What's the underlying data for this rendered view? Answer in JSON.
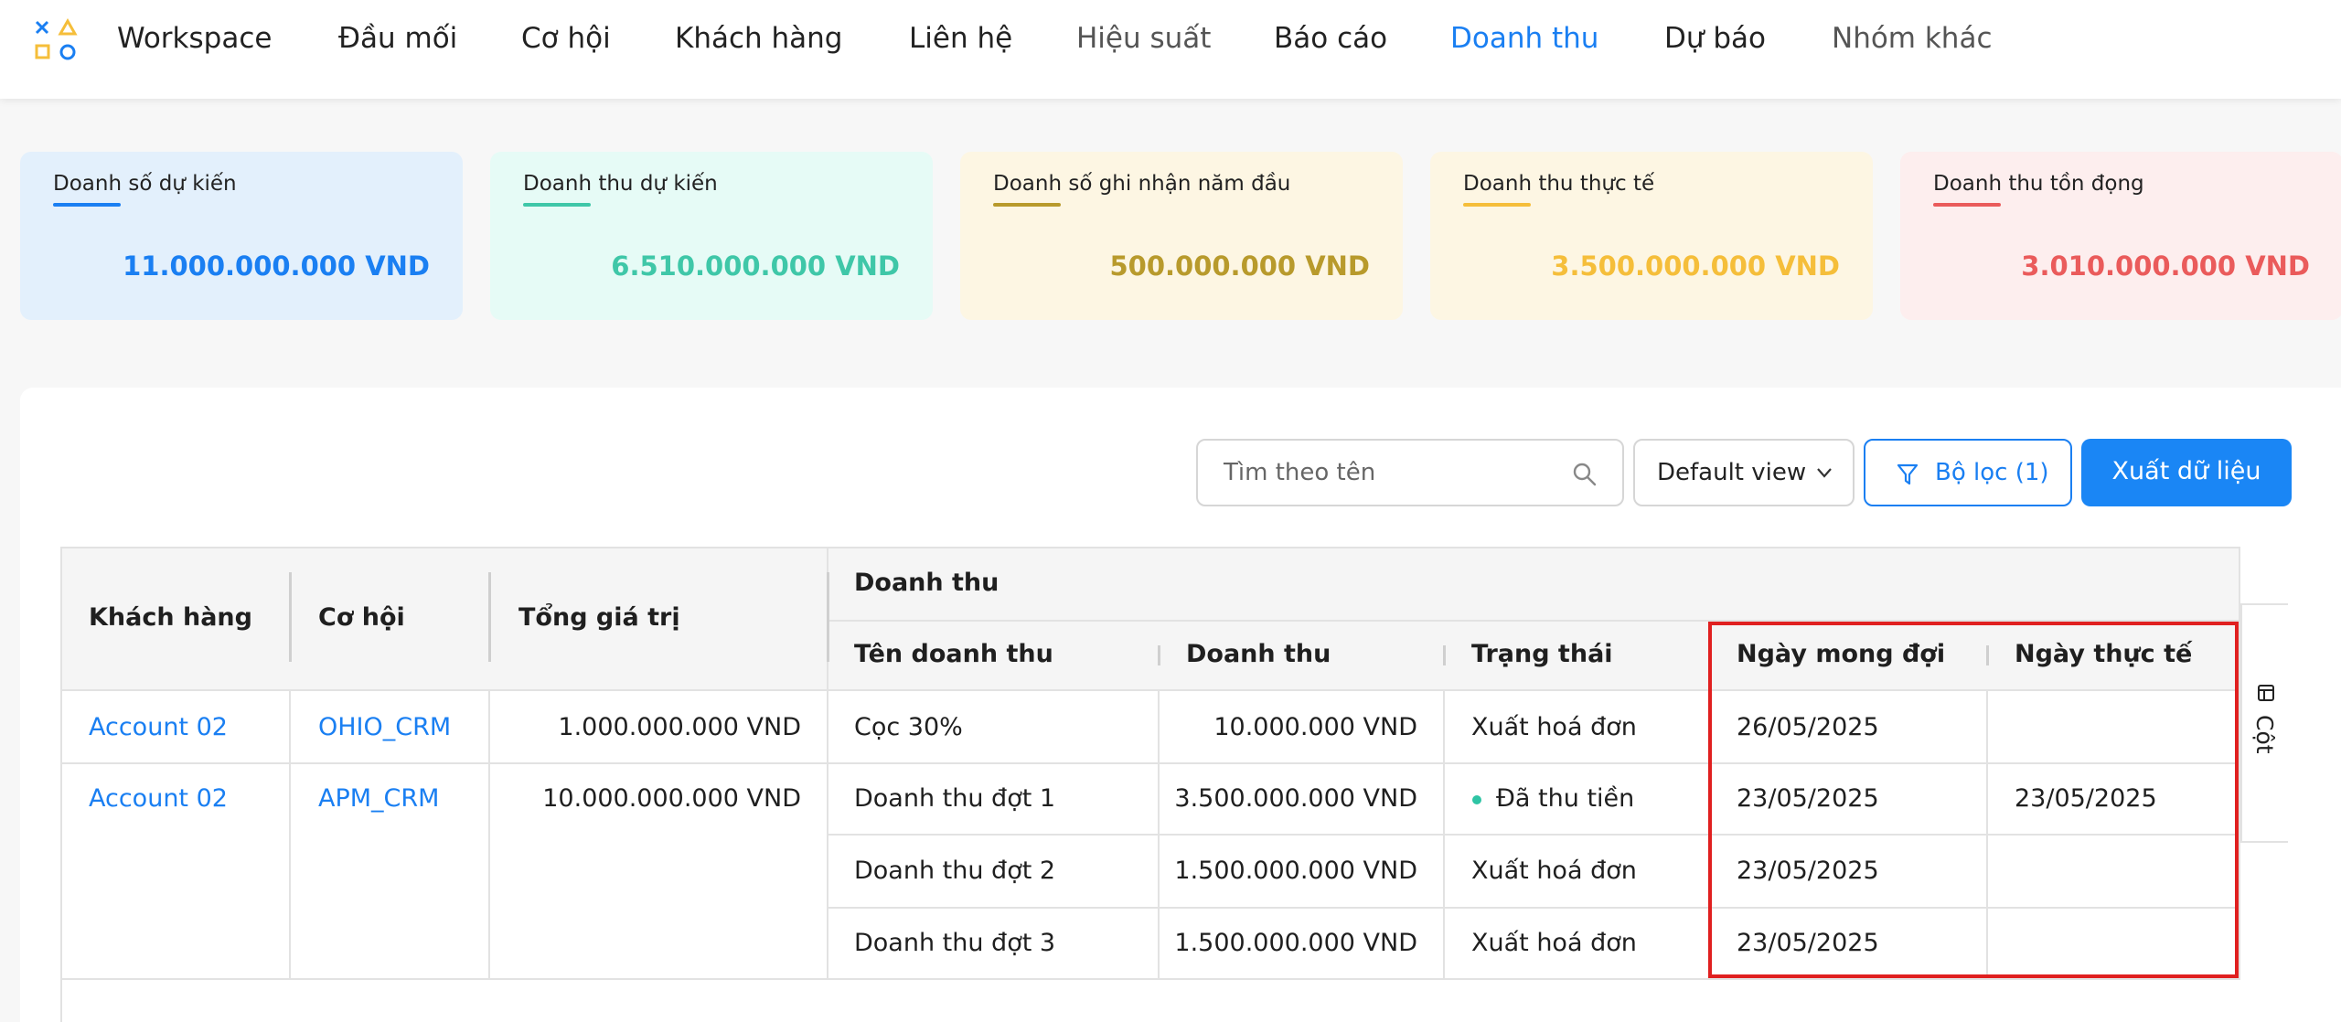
{
  "nav": {
    "items": [
      {
        "label": "Workspace"
      },
      {
        "label": "Đầu mối"
      },
      {
        "label": "Cơ hội"
      },
      {
        "label": "Khách hàng"
      },
      {
        "label": "Liên hệ"
      },
      {
        "label": "Hiệu suất"
      },
      {
        "label": "Báo cáo"
      },
      {
        "label": "Doanh thu"
      },
      {
        "label": "Dự báo"
      },
      {
        "label": "Nhóm khác"
      }
    ],
    "active": "Doanh thu"
  },
  "cards": [
    {
      "label": "Doanh số dự kiến",
      "value": "11.000.000.000 VND",
      "bg": "#e3f0fc",
      "accent": "#1a7ff2"
    },
    {
      "label": "Doanh thu dự kiến",
      "value": "6.510.000.000 VND",
      "bg": "#e6fbf6",
      "accent": "#3fc7a8"
    },
    {
      "label": "Doanh số ghi nhận năm đầu",
      "value": "500.000.000 VND",
      "bg": "#fdf6e3",
      "accent": "#b89a2c"
    },
    {
      "label": "Doanh thu thực tế",
      "value": "3.500.000.000 VND",
      "bg": "#fdf6e3",
      "accent": "#f5be3a"
    },
    {
      "label": "Doanh thu tồn đọng",
      "value": "3.010.000.000 VND",
      "bg": "#fdeeee",
      "accent": "#ea5b5b"
    }
  ],
  "toolbar": {
    "search_placeholder": "Tìm theo tên",
    "view_label": "Default view",
    "filter_label": "Bộ lọc (1)",
    "export_label": "Xuất dữ liệu"
  },
  "table": {
    "headers": {
      "customer": "Khách hàng",
      "opportunity": "Cơ hội",
      "total": "Tổng giá trị",
      "group": "Doanh thu",
      "revenue_name": "Tên doanh thu",
      "revenue": "Doanh thu",
      "status": "Trạng thái",
      "expected_date": "Ngày mong đợi",
      "actual_date": "Ngày thực tế"
    },
    "rows": [
      {
        "customer": "Account 02",
        "opportunity": "OHIO_CRM",
        "total": "1.000.000.000 VND",
        "revenue_name": "Cọc 30%",
        "revenue": "10.000.000 VND",
        "status": "Xuất hoá đơn",
        "expected_date": "26/05/2025",
        "actual_date": ""
      },
      {
        "customer": "Account 02",
        "opportunity": "APM_CRM",
        "total": "10.000.000.000 VND",
        "revenue_name": "Doanh thu đợt 1",
        "revenue": "3.500.000.000 VND",
        "status": "Đã thu tiền",
        "expected_date": "23/05/2025",
        "actual_date": "23/05/2025"
      },
      {
        "customer": "",
        "opportunity": "",
        "total": "",
        "revenue_name": "Doanh thu đợt 2",
        "revenue": "1.500.000.000 VND",
        "status": "Xuất hoá đơn",
        "expected_date": "23/05/2025",
        "actual_date": ""
      },
      {
        "customer": "",
        "opportunity": "",
        "total": "",
        "revenue_name": "Doanh thu đợt 3",
        "revenue": "1.500.000.000 VND",
        "status": "Xuất hoá đơn",
        "expected_date": "23/05/2025",
        "actual_date": ""
      }
    ],
    "columns_tab_label": "Cột"
  },
  "colors": {
    "accent": "#1a7ff2",
    "highlight_border": "#e02020",
    "status_paid_dot": "#2ec4a4"
  }
}
